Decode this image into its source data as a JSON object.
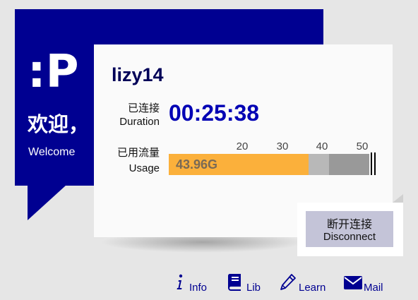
{
  "brand": {
    "logo_text": ":P",
    "welcome_cn": "欢迎，",
    "welcome_en": "Welcome"
  },
  "session": {
    "username": "lizy14",
    "duration_label_cn": "已连接",
    "duration_label_en": "Duration",
    "duration_value": "00:25:38",
    "usage_label_cn": "已用流量",
    "usage_label_en": "Usage",
    "usage_value": "43.96G",
    "usage_gb": 43.96
  },
  "usage_scale": {
    "ticks": [
      "20",
      "30",
      "40",
      "50"
    ]
  },
  "actions": {
    "disconnect_cn": "断开连接",
    "disconnect_en": "Disconnect"
  },
  "links": [
    {
      "label": "Info",
      "icon": "info-icon"
    },
    {
      "label": "Lib",
      "icon": "book-icon"
    },
    {
      "label": "Learn",
      "icon": "pencil-icon"
    },
    {
      "label": "Mail",
      "icon": "mail-icon"
    }
  ],
  "colors": {
    "brand_blue": "#000091",
    "accent_blue": "#0000b4",
    "usage_orange": "#fbb03b",
    "button_bg": "#c4c4d8"
  }
}
